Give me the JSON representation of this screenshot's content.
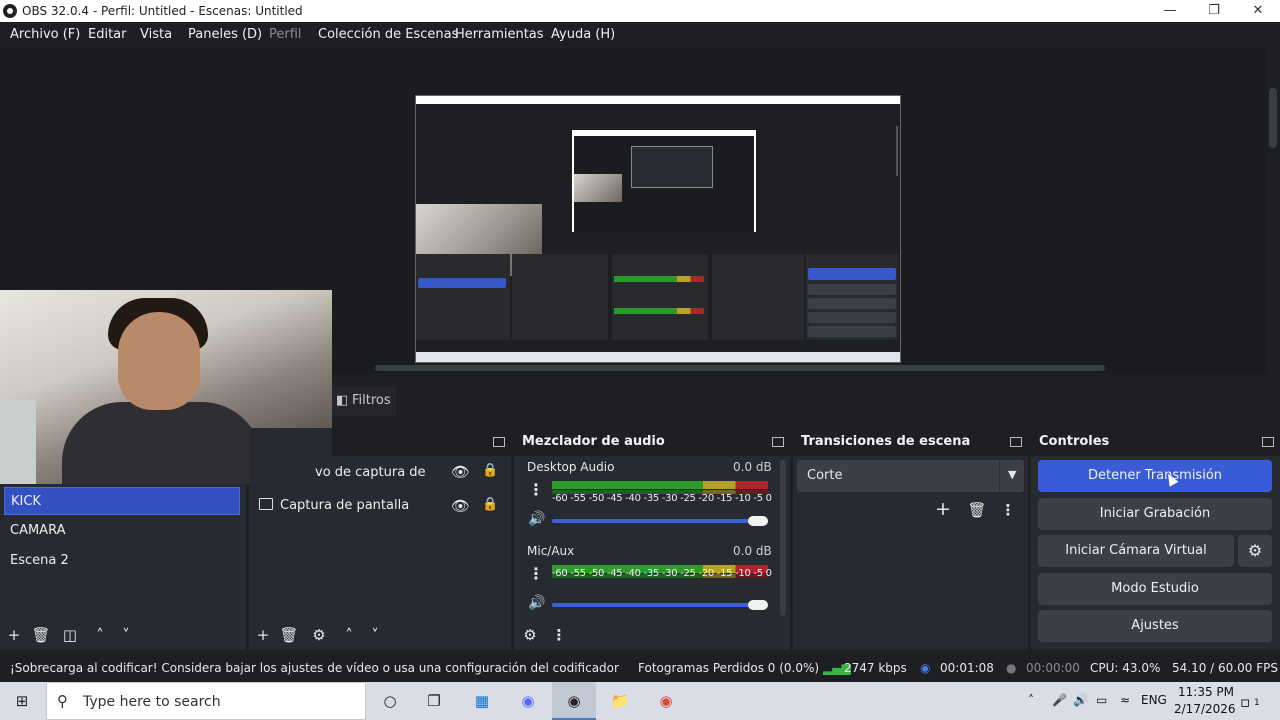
{
  "window": {
    "title": "OBS 32.0.4 - Perfil: Untitled - Escenas: Untitled"
  },
  "menu": [
    {
      "label": "Archivo (F)",
      "enabled": true
    },
    {
      "label": "Editar",
      "enabled": true
    },
    {
      "label": "Vista",
      "enabled": true
    },
    {
      "label": "Paneles (D)",
      "enabled": true
    },
    {
      "label": "Perfil",
      "enabled": false
    },
    {
      "label": "Colección de Escenas",
      "enabled": true
    },
    {
      "label": "Herramientas",
      "enabled": true
    },
    {
      "label": "Ayuda (H)",
      "enabled": true
    }
  ],
  "tabs": {
    "filters": "Filtros"
  },
  "scenes": {
    "items": [
      "KICK",
      "CAMARA",
      "Escena 2"
    ],
    "selected": 0
  },
  "sources": {
    "items": [
      {
        "label": "vo de captura de vide",
        "visible": true,
        "locked": true
      },
      {
        "label": "Captura de pantalla",
        "visible": true,
        "locked": true
      }
    ]
  },
  "mixer": {
    "title": "Mezclador de audio",
    "scale": "-60 -55 -50 -45 -40 -35 -30 -25 -20 -15 -10  -5   0",
    "channels": [
      {
        "name": "Desktop Audio",
        "db": "0.0 dB",
        "volume": 1.0
      },
      {
        "name": "Mic/Aux",
        "db": "0.0 dB",
        "volume": 1.0
      }
    ]
  },
  "transitions": {
    "title": "Transiciones de escena",
    "selected": "Corte"
  },
  "controls": {
    "title": "Controles",
    "buttons": {
      "stop_stream": "Detener Transmisión",
      "start_record": "Iniciar Grabación",
      "virtual_cam": "Iniciar Cámara Virtual",
      "studio_mode": "Modo Estudio",
      "settings": "Ajustes"
    }
  },
  "status": {
    "warning": "¡Sobrecarga al codificar! Considera bajar los ajustes de vídeo o usa una configuración del codificador más rápi",
    "dropped_frames": "Fotogramas Perdidos 0 (0.0%)",
    "bitrate": "2747 kbps",
    "stream_time": "00:01:08",
    "record_time": "00:00:00",
    "cpu": "CPU: 43.0%",
    "fps": "54.10 / 60.00 FPS"
  },
  "taskbar": {
    "search_placeholder": "Type here to search",
    "lang": "ENG",
    "time": "11:35 PM",
    "date": "2/17/2026",
    "notifications": "1"
  },
  "colors": {
    "accent": "#3a5bd6",
    "background": "#1e1f23",
    "dock": "#272a30"
  }
}
